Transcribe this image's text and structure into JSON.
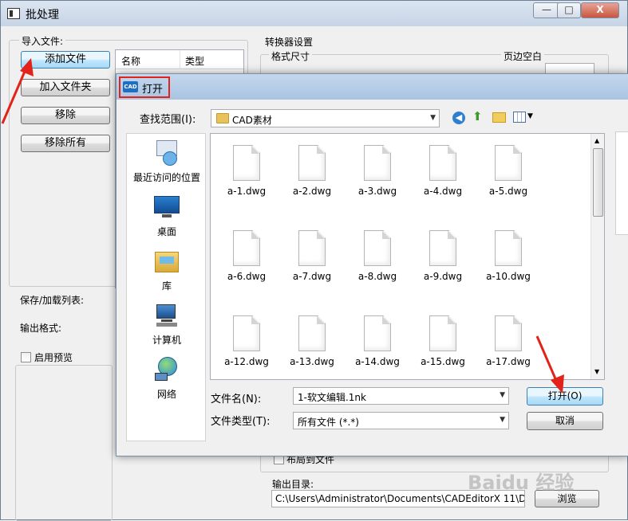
{
  "main_window": {
    "title": "批处理",
    "window_controls": {
      "minimize": "—",
      "maximize": "□",
      "close": "X"
    },
    "import_group_title": "导入文件:",
    "buttons": {
      "add_file": "添加文件",
      "add_folder": "加入文件夹",
      "remove": "移除",
      "remove_all": "移除所有"
    },
    "list_headers": {
      "name": "名称",
      "type": "类型"
    },
    "save_load_label": "保存/加载列表:",
    "output_format_label": "输出格式:",
    "enable_preview_label": "启用预览",
    "converter_settings_title": "转换器设置",
    "format_size_title": "格式尺寸",
    "margin_title": "页边空白",
    "layout_checkbox_label": "布局到文件",
    "output_dir_label": "输出目录:",
    "output_dir_value": "C:\\Users\\Administrator\\Documents\\CADEditorX 11\\D",
    "browse_button": "浏览",
    "watermark": "Baidu 经验"
  },
  "dialog": {
    "title": "打开",
    "icon_text": "CAD",
    "look_in_label": "查找范围(I):",
    "look_in_value": "CAD素材",
    "places": [
      {
        "label": "最近访问的位置",
        "icon": "recent-places-icon"
      },
      {
        "label": "桌面",
        "icon": "desktop-icon"
      },
      {
        "label": "库",
        "icon": "library-icon"
      },
      {
        "label": "计算机",
        "icon": "computer-icon"
      },
      {
        "label": "网络",
        "icon": "network-icon"
      }
    ],
    "files": [
      "a-1.dwg",
      "a-2.dwg",
      "a-3.dwg",
      "a-4.dwg",
      "a-5.dwg",
      "a-6.dwg",
      "a-7.dwg",
      "a-8.dwg",
      "a-9.dwg",
      "a-10.dwg",
      "a-12.dwg",
      "a-13.dwg",
      "a-14.dwg",
      "a-15.dwg",
      "a-17.dwg"
    ],
    "filename_label": "文件名(N):",
    "filename_value": "1-软文编辑.1nk",
    "filetype_label": "文件类型(T):",
    "filetype_value": "所有文件 (*.*)",
    "open_button": "打开(O)",
    "cancel_button": "取消"
  },
  "colors": {
    "highlight": "#e2231a",
    "accent": "#1e6fc2"
  }
}
